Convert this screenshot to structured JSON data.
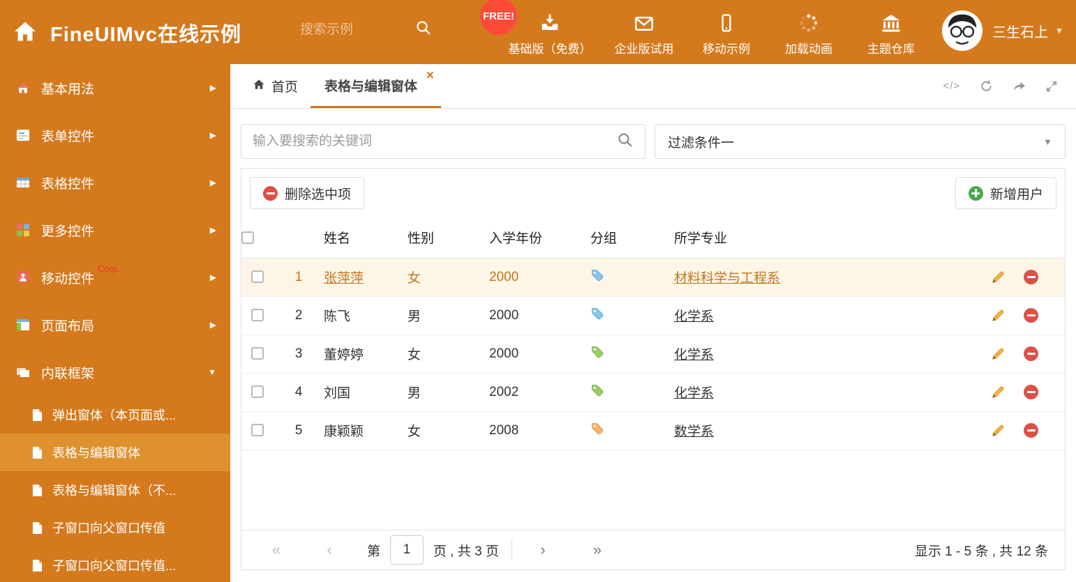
{
  "colors": {
    "primary": "#d5791d",
    "sidebar_active_bg": "#e0912f",
    "selected_row_bg": "#fdf6e7",
    "selected_row_text": "#c4751c",
    "free_badge_bg": "#ff4a39",
    "tag_blue": "#85c4ec",
    "tag_green": "#9ccc65",
    "tag_orange": "#f6b26b",
    "delete_red": "#dd5044",
    "add_green": "#49a84d"
  },
  "icons": {
    "chevron_right": "▶",
    "chevron_down": "▼",
    "caret_down": "▼",
    "close": "×",
    "code": "</>",
    "pg_first": "«",
    "pg_prev": "‹",
    "pg_next": "›",
    "pg_last": "»"
  },
  "header": {
    "title": "FineUIMvc在线示例",
    "search_placeholder": "搜索示例",
    "free_badge": "FREE!",
    "nav": [
      {
        "label": "基础版（免费）"
      },
      {
        "label": "企业版试用"
      },
      {
        "label": "移动示例"
      },
      {
        "label": "加载动画"
      },
      {
        "label": "主题仓库"
      }
    ],
    "user_name": "三生石上"
  },
  "sidebar": {
    "items": [
      {
        "label": "基本用法"
      },
      {
        "label": "表单控件"
      },
      {
        "label": "表格控件"
      },
      {
        "label": "更多控件"
      },
      {
        "label": "移动控件",
        "badge": "Corp."
      },
      {
        "label": "页面布局"
      },
      {
        "label": "内联框架"
      }
    ],
    "subitems": [
      {
        "label": "弹出窗体（本页面或..."
      },
      {
        "label": "表格与编辑窗体"
      },
      {
        "label": "表格与编辑窗体（不..."
      },
      {
        "label": "子窗口向父窗口传值"
      },
      {
        "label": "子窗口向父窗口传值..."
      }
    ]
  },
  "tabs": {
    "home": "首页",
    "active": "表格与编辑窗体"
  },
  "filters": {
    "search_placeholder": "输入要搜索的关键词",
    "filter_selected": "过滤条件一"
  },
  "toolbar": {
    "delete_label": "删除选中项",
    "add_label": "新增用户"
  },
  "table": {
    "columns": {
      "name": "姓名",
      "gender": "性别",
      "year": "入学年份",
      "group": "分组",
      "major": "所学专业"
    },
    "rows": [
      {
        "num": "1",
        "name": "张萍萍",
        "gender": "女",
        "year": "2000",
        "tag": "blue",
        "major": "材料科学与工程系"
      },
      {
        "num": "2",
        "name": "陈飞",
        "gender": "男",
        "year": "2000",
        "tag": "blue",
        "major": "化学系"
      },
      {
        "num": "3",
        "name": "董婷婷",
        "gender": "女",
        "year": "2000",
        "tag": "green",
        "major": "化学系"
      },
      {
        "num": "4",
        "name": "刘国",
        "gender": "男",
        "year": "2002",
        "tag": "green",
        "major": "化学系"
      },
      {
        "num": "5",
        "name": "康颖颖",
        "gender": "女",
        "year": "2008",
        "tag": "orange",
        "major": "数学系"
      }
    ]
  },
  "pagination": {
    "label_prefix": "第",
    "page_value": "1",
    "label_suffix": "页 , 共 3 页",
    "summary": "显示 1 - 5 条 , 共 12 条"
  }
}
